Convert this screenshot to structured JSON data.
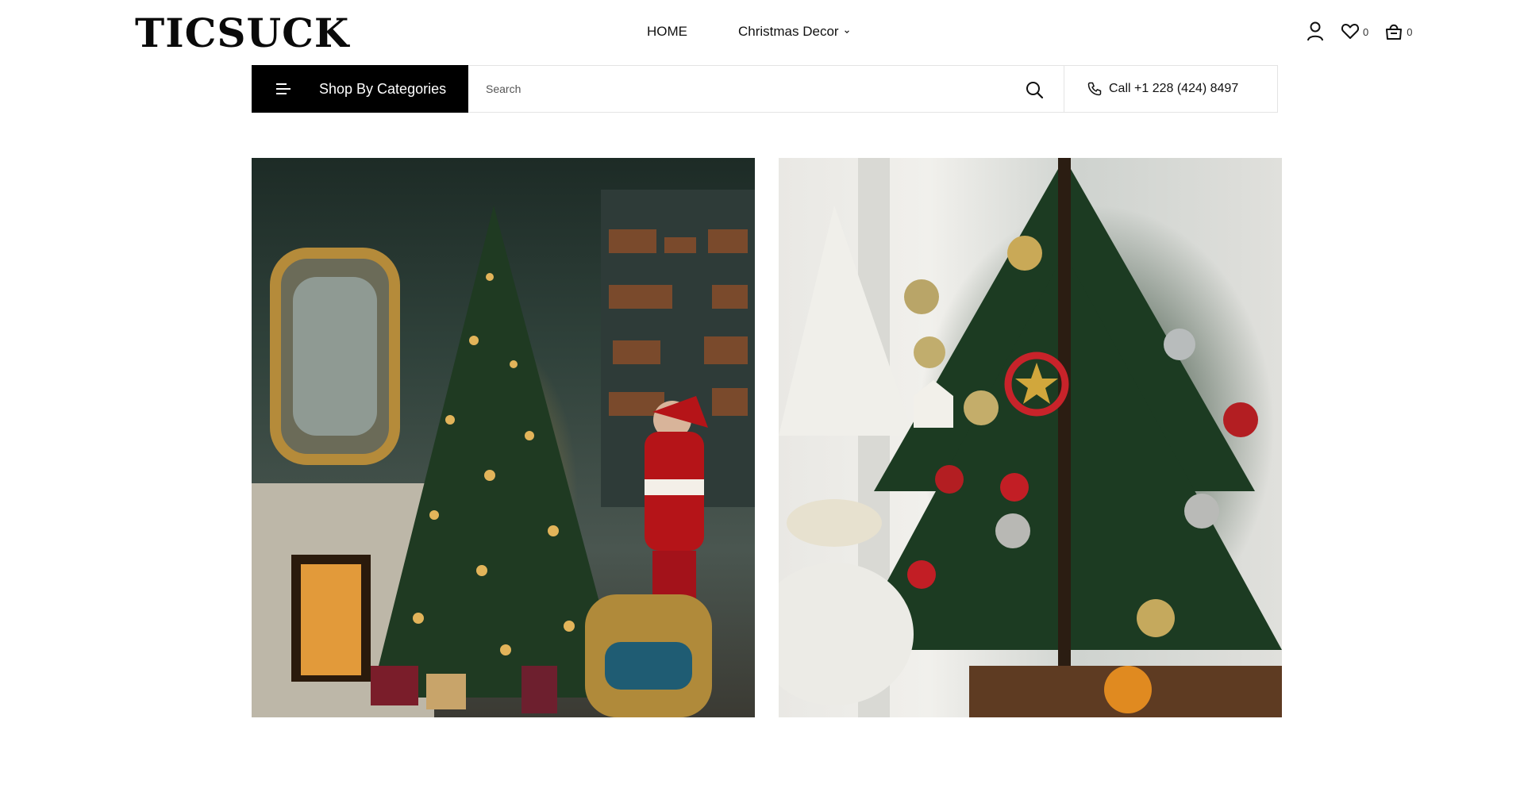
{
  "brand": {
    "logo_text": "TICSUCK"
  },
  "nav": {
    "items": [
      {
        "label": "HOME",
        "has_dropdown": false
      },
      {
        "label": "Christmas Decor",
        "has_dropdown": true
      }
    ]
  },
  "header_icons": {
    "account_icon": "user-icon",
    "wishlist_icon": "heart-icon",
    "wishlist_count": "0",
    "cart_icon": "shopping-bag-icon",
    "cart_count": "0"
  },
  "searchbar": {
    "categories_label": "Shop By Categories",
    "categories_icon": "menu-icon",
    "search_placeholder": "Search",
    "search_value": "",
    "search_icon": "search-icon",
    "phone_icon": "phone-icon",
    "phone_text": "Call +1 228 (424) 8497"
  },
  "gallery": {
    "images": [
      {
        "subject": "Santa decorating Christmas tree in ornate room"
      },
      {
        "subject": "Christmas tree with red and gold ornaments"
      }
    ]
  },
  "colors": {
    "accent": "#000000",
    "background": "#ffffff",
    "border": "#e4e4e4"
  }
}
